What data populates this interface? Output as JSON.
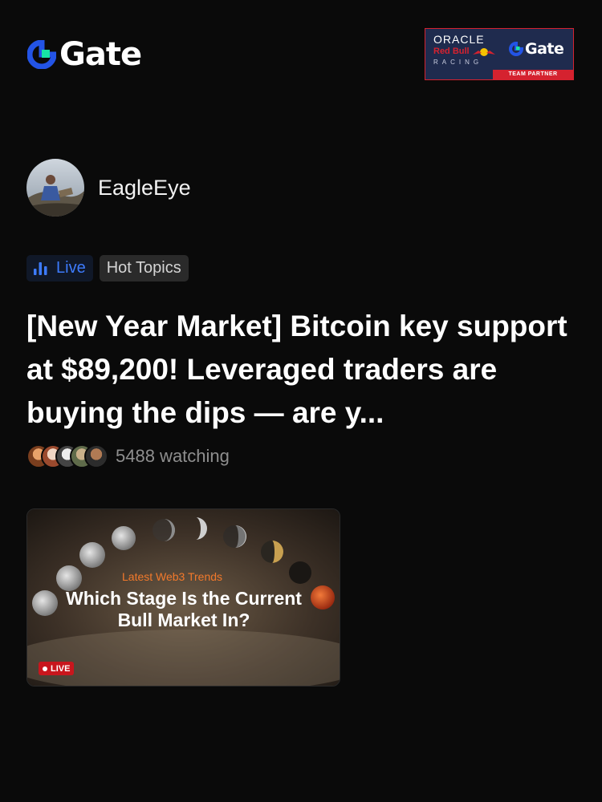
{
  "brand": {
    "name": "Gate",
    "accent": "#2354e6"
  },
  "partner_banner": {
    "oracle": "ORACLE",
    "redbull": "Red Bull",
    "racing": "RACING",
    "gate": "Gate",
    "footer": "TEAM PARTNER"
  },
  "author": {
    "name": "EagleEye"
  },
  "tags": {
    "live": "Live",
    "topic": "Hot Topics"
  },
  "headline": "[New Year Market] Bitcoin key support at $89,200! Leveraged traders are buying the dips — are y...",
  "watching": {
    "text": "5488 watching",
    "faces": [
      "face-1",
      "face-2",
      "face-3",
      "face-4",
      "face-5"
    ]
  },
  "card": {
    "kicker": "Latest Web3 Trends",
    "title": "Which Stage Is the Current Bull Market In?",
    "badge": "LIVE"
  }
}
